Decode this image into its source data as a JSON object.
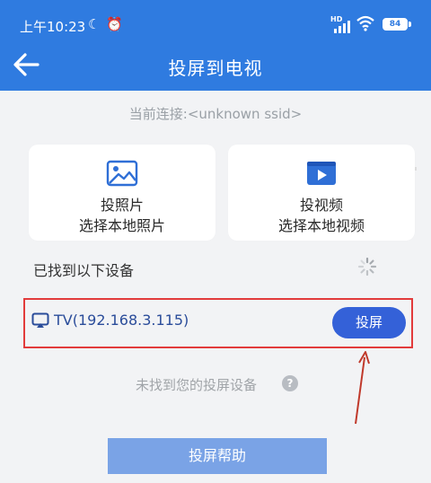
{
  "status_bar": {
    "time": "上午10:23",
    "hd_label": "HD",
    "battery": "84"
  },
  "header": {
    "title": "投屏到电视"
  },
  "connection": {
    "text": "当前连接:<unknown ssid>"
  },
  "cards": [
    {
      "title": "投照片",
      "subtitle": "选择本地照片",
      "icon": "image-icon"
    },
    {
      "title": "投视频",
      "subtitle": "选择本地视频",
      "icon": "video-icon"
    }
  ],
  "devices": {
    "section_label": "已找到以下设备",
    "items": [
      {
        "name": "TV(192.168.3.115)",
        "action": "投屏"
      }
    ]
  },
  "not_found": {
    "text": "未找到您的投屏设备",
    "help_glyph": "?"
  },
  "help_button": {
    "label": "投屏帮助"
  },
  "colors": {
    "primary": "#2f7be0",
    "cast_button": "#3461d8",
    "highlight_border": "#e23b3b",
    "help_button": "#7aa3e6"
  }
}
